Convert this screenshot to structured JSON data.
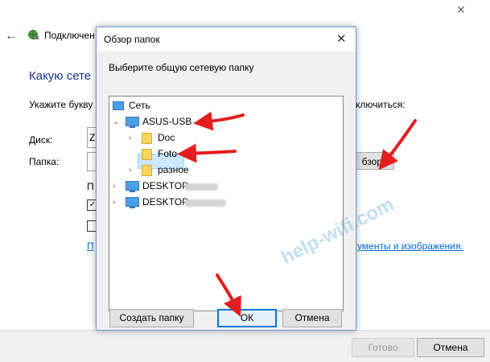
{
  "wizard": {
    "title": "Подключен",
    "heading": "Какую сете",
    "instruction": "Укажите букву",
    "instruction_tail": "ключиться:",
    "disk_label": "Диск:",
    "disk_value": "Z",
    "folder_label": "Папка:",
    "browse_button": "бзор...",
    "truncated_text": "П",
    "checkbox_1_checked": true,
    "link_left": "П",
    "link_right": "окументы и изображения.",
    "ready_button": "Готово",
    "cancel_button": "Отмена"
  },
  "dialog": {
    "title": "Обзор папок",
    "instruction": "Выберите общую сетевую папку",
    "tree": {
      "root": "Сеть",
      "device": "ASUS-USB",
      "children": [
        "Doc",
        "Foto",
        "разное"
      ],
      "selected": "Foto",
      "desktop_1": "DESKTOP",
      "desktop_2": "DESKTOP"
    },
    "buttons": {
      "new_folder": "Создать папку",
      "ok": "ОК",
      "cancel": "Отмена"
    }
  },
  "watermark": "help-wifi.com",
  "colors": {
    "arrow": "#e31e1e",
    "heading": "#1e3287",
    "link": "#0066cc",
    "selection": "#cce8ff"
  }
}
